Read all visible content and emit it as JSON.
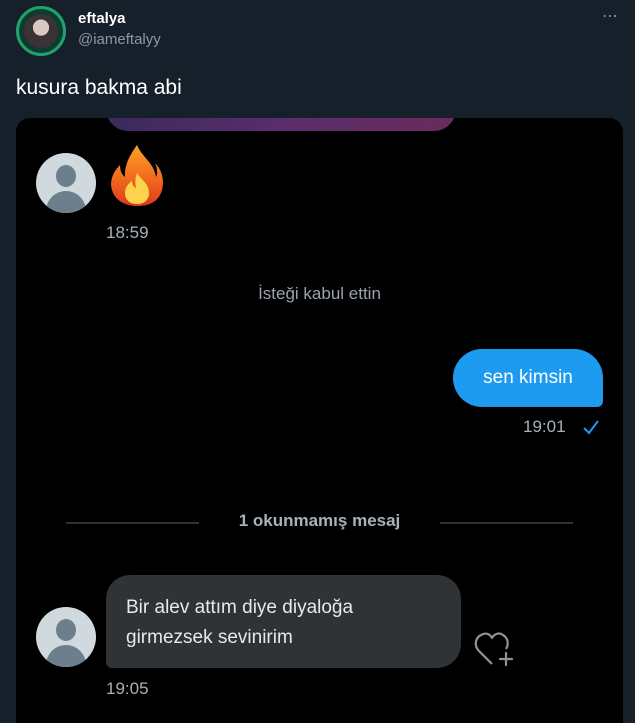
{
  "tweet": {
    "author": {
      "display_name": "eftalya",
      "handle": "@iameftalyy",
      "avatar_icon": "profile-photo"
    },
    "more_icon": "⋯",
    "text": "kusura bakma abi"
  },
  "dm": {
    "first_message": {
      "emoji_icon": "fire-emoji",
      "time": "18:59"
    },
    "system_message": "İsteği kabul ettin",
    "sent_message": {
      "text": "sen kimsin",
      "time": "19:01",
      "status_icon": "check-icon"
    },
    "unread_divider": "1 okunmamış mesaj",
    "received_message": {
      "line1": "Bir alev attım diye diyaloğa",
      "line2": "girmezsek sevinirim",
      "time": "19:05",
      "reaction_icon": "heart-add-icon"
    }
  },
  "colors": {
    "page_background": "#15202b",
    "card_background": "#000000",
    "sent_bubble": "#1d9bf0",
    "received_bubble": "#2f3336",
    "muted_text": "#8899a6"
  }
}
